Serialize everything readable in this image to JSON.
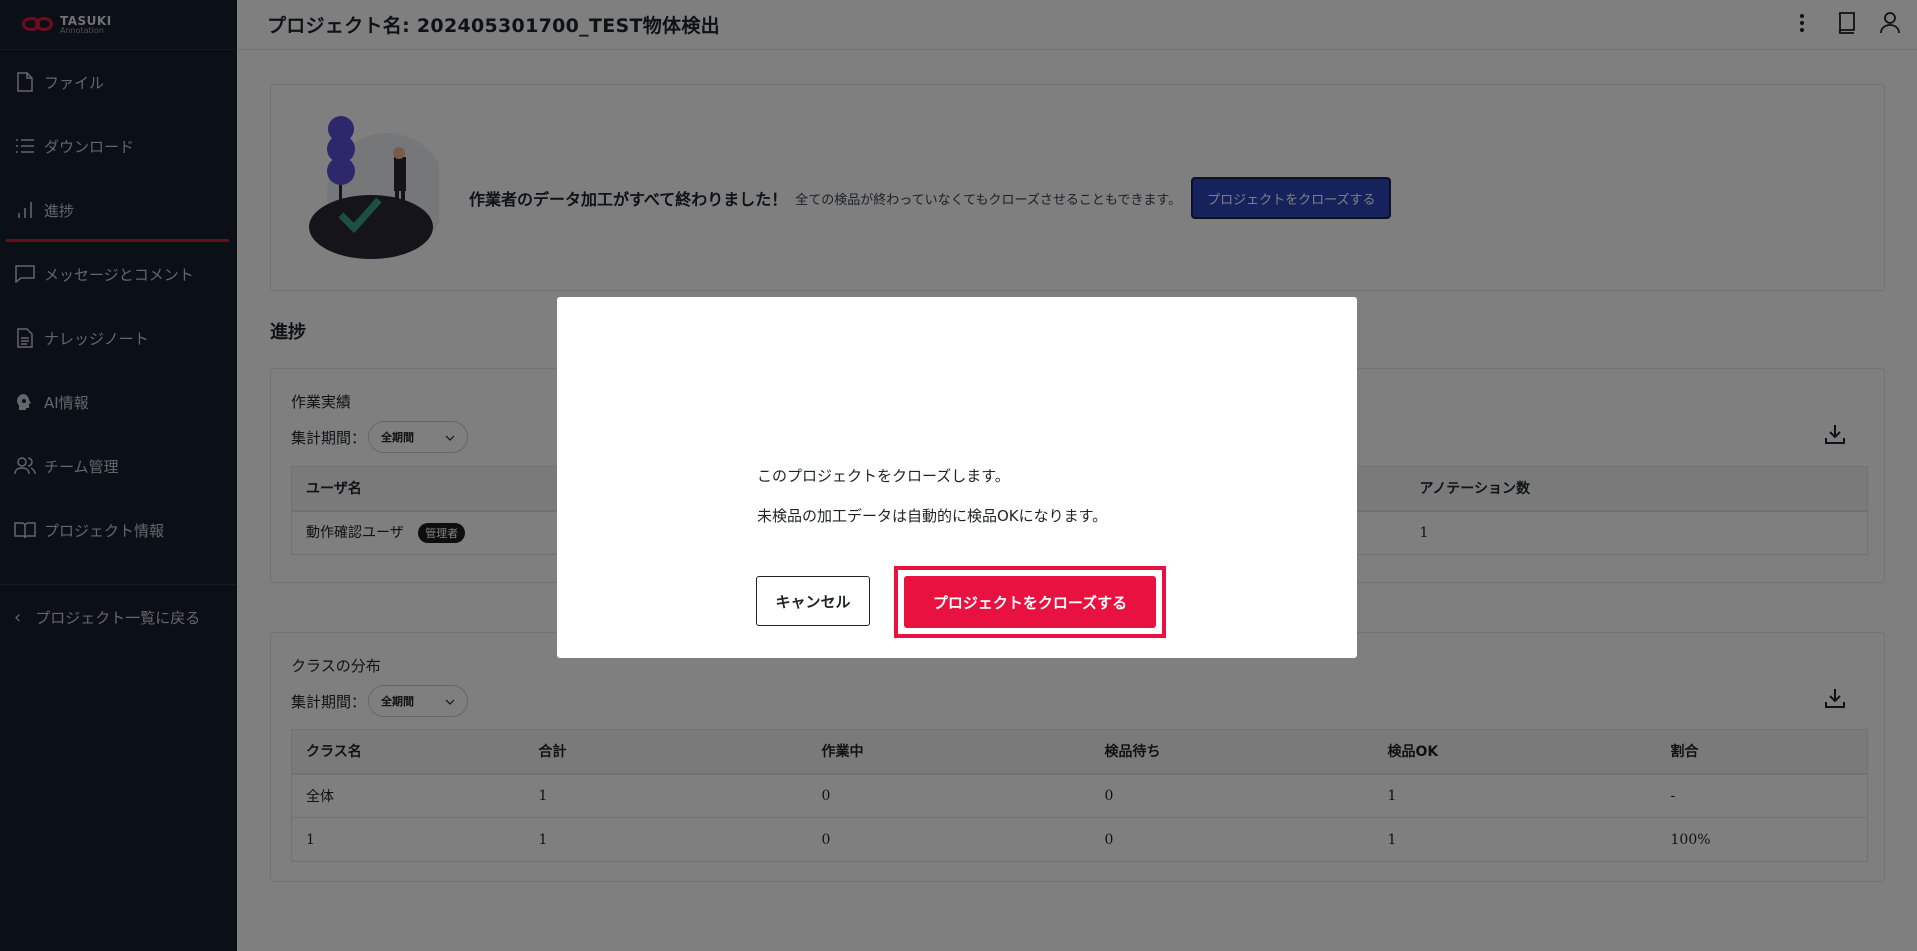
{
  "brand": {
    "name": "TASUKI",
    "sub": "Annotation"
  },
  "sidebar": {
    "items": [
      {
        "label": "ファイル",
        "icon": "file-icon"
      },
      {
        "label": "ダウンロード",
        "icon": "list-icon"
      },
      {
        "label": "進捗",
        "icon": "chart-icon",
        "active": true
      },
      {
        "label": "メッセージとコメント",
        "icon": "message-icon"
      },
      {
        "label": "ナレッジノート",
        "icon": "document-icon"
      },
      {
        "label": "AI情報",
        "icon": "ai-head-icon"
      },
      {
        "label": "チーム管理",
        "icon": "team-icon"
      },
      {
        "label": "プロジェクト情報",
        "icon": "book-open-icon"
      }
    ],
    "back_label": "プロジェクト一覧に戻る"
  },
  "header": {
    "title": "プロジェクト名: 202405301700_TEST物体検出"
  },
  "banner": {
    "headline": "作業者のデータ加工がすべて終わりました！",
    "note": "全ての検品が終わっていなくてもクローズさせることもできます。",
    "button": "プロジェクトをクローズする"
  },
  "progress": {
    "section_title": "進捗",
    "performance": {
      "title": "作業実績",
      "period_label": "集計期間：",
      "period_value": "全期間",
      "columns": [
        "ユーザ名",
        "アノテーション数"
      ],
      "rows": [
        {
          "user": "動作確認ユーザ",
          "badge": "管理者",
          "annotations": "1"
        }
      ]
    },
    "distribution": {
      "title": "クラスの分布",
      "period_label": "集計期間：",
      "period_value": "全期間",
      "columns": [
        "クラス名",
        "合計",
        "作業中",
        "検品待ち",
        "検品OK",
        "割合"
      ],
      "rows": [
        [
          "全体",
          "1",
          "0",
          "0",
          "1",
          "-"
        ],
        [
          "1",
          "1",
          "0",
          "0",
          "1",
          "100%"
        ]
      ]
    }
  },
  "modal": {
    "line1": "このプロジェクトをクローズします。",
    "line2": "未検品の加工データは自動的に検品OKになります。",
    "cancel": "キャンセル",
    "confirm": "プロジェクトをクローズする"
  }
}
